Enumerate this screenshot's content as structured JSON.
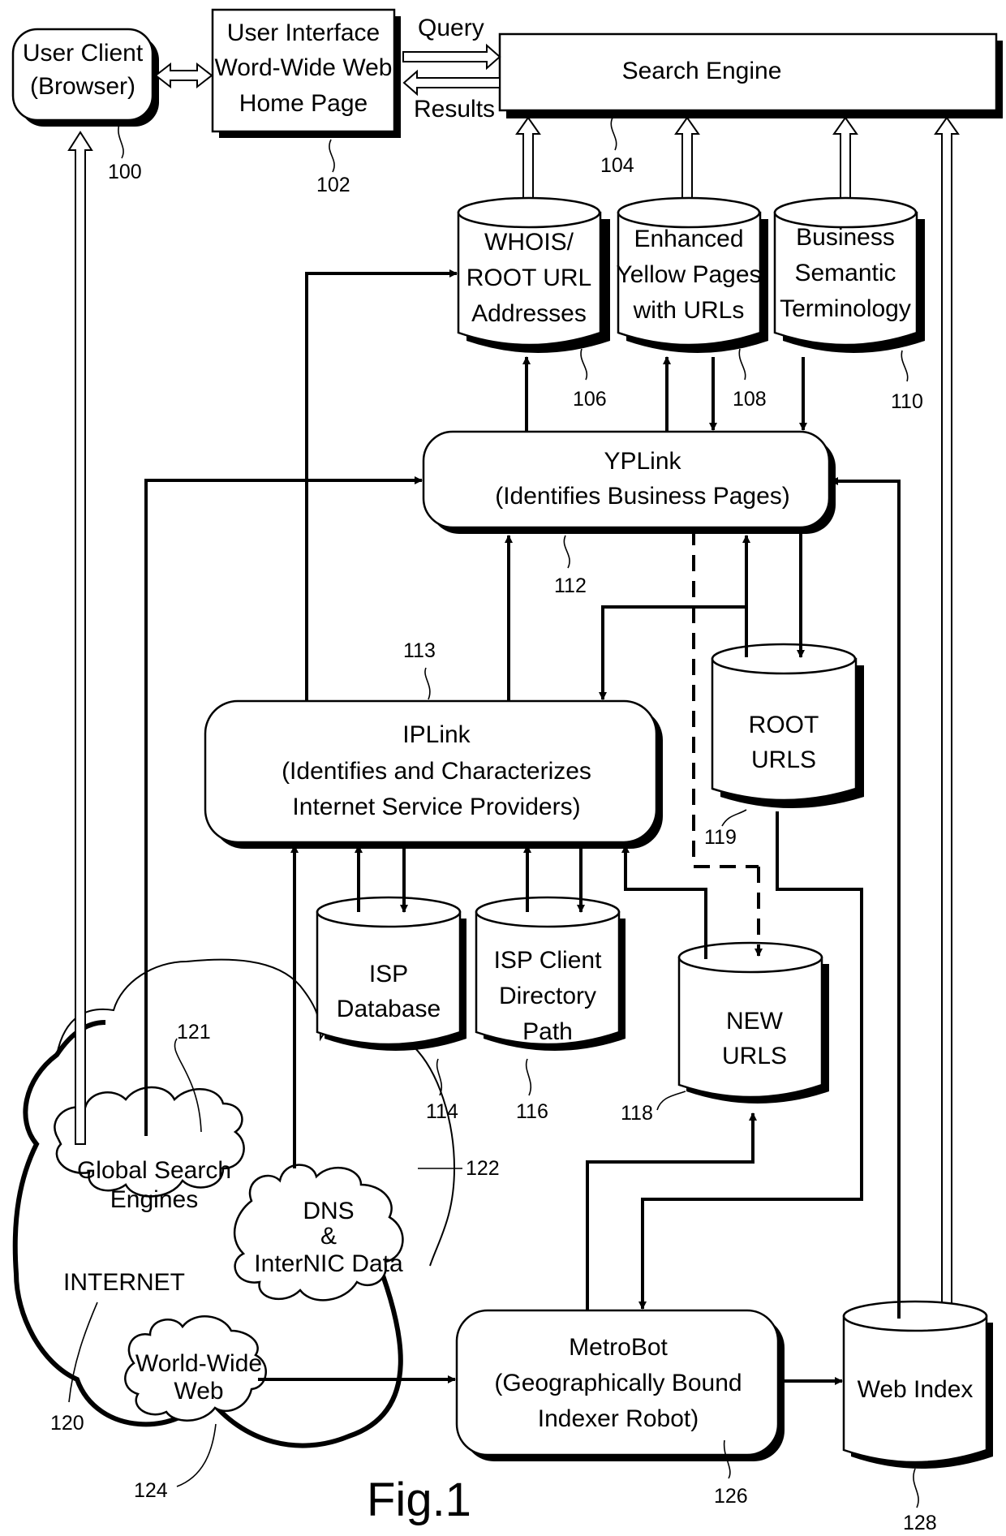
{
  "figure": {
    "caption": "Fig.1",
    "nodes": {
      "user_client": {
        "lines": [
          "User Client",
          "(Browser)"
        ],
        "ref": "100"
      },
      "user_interface": {
        "lines": [
          "User Interface",
          "Word-Wide Web",
          "Home Page"
        ],
        "ref": "102"
      },
      "search_engine": {
        "lines": [
          "Search Engine"
        ],
        "ref": "104"
      },
      "whois": {
        "lines": [
          "WHOIS/",
          "ROOT URL",
          "Addresses"
        ],
        "ref": "106"
      },
      "yellow_pages": {
        "lines": [
          "Enhanced",
          "Yellow Pages",
          "with URLs"
        ],
        "ref": "108"
      },
      "business_semantic": {
        "lines": [
          "Business",
          "Semantic",
          "Terminology"
        ],
        "ref": "110"
      },
      "yplink": {
        "lines": [
          "YPLink",
          "(Identifies Business Pages)"
        ],
        "ref": "112"
      },
      "iplink": {
        "lines": [
          "IPLink",
          "(Identifies and Characterizes",
          "Internet Service Providers)"
        ],
        "ref": "113"
      },
      "isp_database": {
        "lines": [
          "ISP",
          "Database"
        ],
        "ref": "114"
      },
      "isp_client": {
        "lines": [
          "ISP Client",
          "Directory",
          "Path"
        ],
        "ref": "116"
      },
      "new_urls": {
        "lines": [
          "NEW",
          "URLS"
        ],
        "ref": "118"
      },
      "root_urls": {
        "lines": [
          "ROOT",
          "URLS"
        ],
        "ref": "119"
      },
      "internet": {
        "lines": [
          "INTERNET"
        ],
        "ref": "120"
      },
      "global_search": {
        "lines": [
          "Global Search",
          "Engines"
        ],
        "ref": "121"
      },
      "dns": {
        "lines": [
          "DNS",
          "&",
          "InterNIC Data"
        ],
        "ref": "122"
      },
      "www": {
        "lines": [
          "World-Wide",
          "Web"
        ],
        "ref": "124"
      },
      "metrobot": {
        "lines": [
          "MetroBot",
          "(Geographically Bound",
          "Indexer Robot)"
        ],
        "ref": "126"
      },
      "web_index": {
        "lines": [
          "Web Index"
        ],
        "ref": "128"
      }
    },
    "edge_labels": {
      "query": "Query",
      "results": "Results"
    }
  }
}
